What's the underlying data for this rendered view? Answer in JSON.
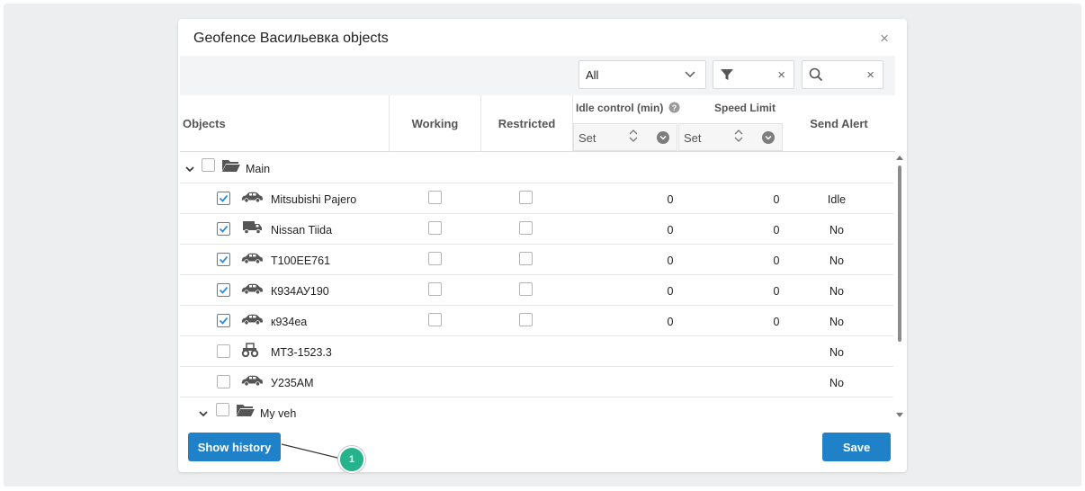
{
  "dialog": {
    "title": "Geofence Васильевка objects",
    "close_glyph": "×"
  },
  "toolbar": {
    "select_value": "All",
    "filter_clear": "×",
    "search_clear": "×"
  },
  "header": {
    "objects": "Objects",
    "working": "Working",
    "restricted": "Restricted",
    "idle_control": "Idle control (min)",
    "speed_limit": "Speed Limit",
    "send_alert": "Send Alert",
    "idle_set": "Set",
    "speed_set": "Set"
  },
  "groups": [
    {
      "name": "Main"
    },
    {
      "name": "My veh"
    }
  ],
  "rows": [
    {
      "name": "Mitsubishi Pajero",
      "icon": "car-icon",
      "checked": true,
      "idle": "0",
      "speed": "0",
      "alert": "Idle"
    },
    {
      "name": "Nissan Tiida",
      "icon": "truck-icon",
      "checked": true,
      "idle": "0",
      "speed": "0",
      "alert": "No"
    },
    {
      "name": "T100EE761",
      "icon": "car-icon",
      "checked": true,
      "idle": "0",
      "speed": "0",
      "alert": "No"
    },
    {
      "name": "К934АУ190",
      "icon": "car-icon",
      "checked": true,
      "idle": "0",
      "speed": "0",
      "alert": "No"
    },
    {
      "name": "к934еа",
      "icon": "car-icon",
      "checked": true,
      "idle": "0",
      "speed": "0",
      "alert": "No"
    },
    {
      "name": "МТЗ-1523.3",
      "icon": "tractor-icon",
      "checked": false,
      "idle": "",
      "speed": "",
      "alert": "No"
    },
    {
      "name": "У235АМ",
      "icon": "car-icon",
      "checked": false,
      "idle": "",
      "speed": "",
      "alert": "No"
    }
  ],
  "footer": {
    "show_history": "Show history",
    "save": "Save",
    "callout_number": "1"
  },
  "colors": {
    "accent": "#1f82c8",
    "check": "#2b8ddf",
    "callout": "#25b38b"
  }
}
